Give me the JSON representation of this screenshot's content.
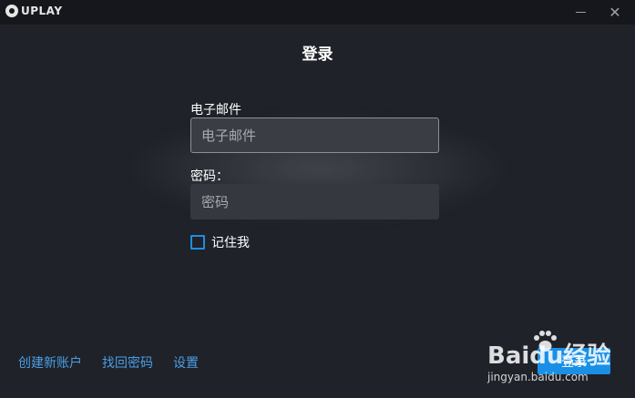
{
  "titlebar": {
    "brand": "UPLAY"
  },
  "main": {
    "title": "登录",
    "email_label": "电子邮件",
    "email_placeholder": "电子邮件",
    "password_label": "密码：",
    "password_placeholder": "密码",
    "remember_label": "记住我",
    "remember_checked": false
  },
  "footer": {
    "links": [
      "创建新账户",
      "找回密码",
      "设置"
    ],
    "login_button": "登录"
  },
  "watermark": {
    "main": "Baidu经验",
    "sub": "jingyan.baidu.com"
  },
  "colors": {
    "background": "#1f2229",
    "accent": "#1a8fe6",
    "link": "#4a9fe6"
  }
}
